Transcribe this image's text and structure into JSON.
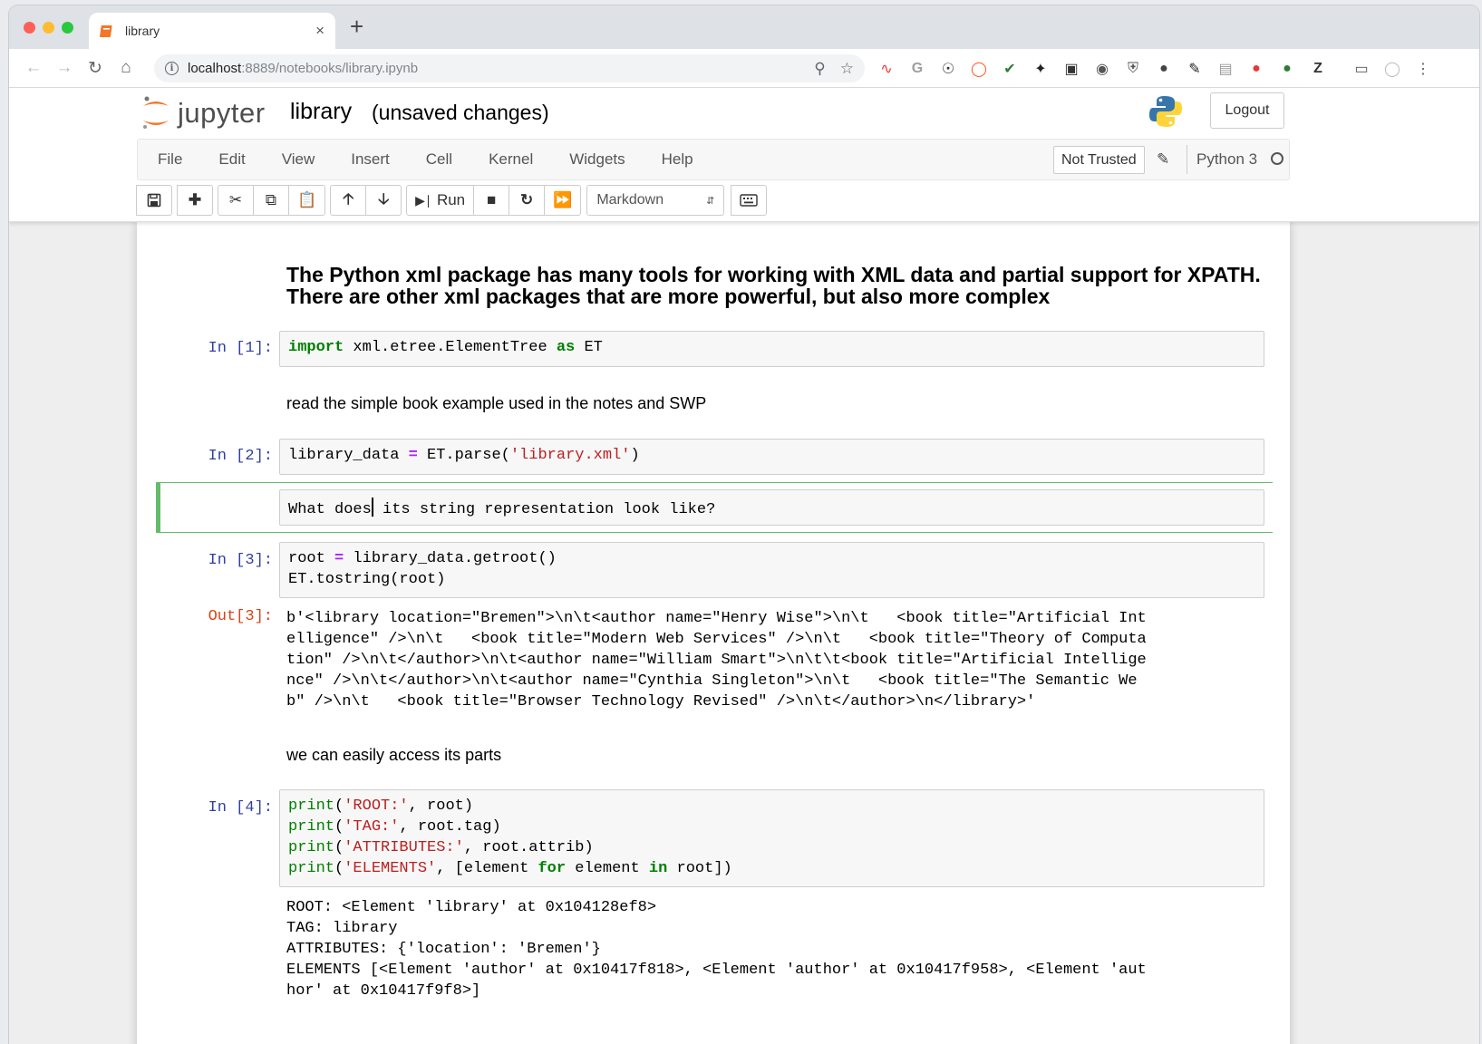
{
  "browser": {
    "tab_title": "library",
    "tab_close": "×",
    "new_tab": "+",
    "url_host": "localhost",
    "url_rest": ":8889/notebooks/library.ipynb",
    "extensions": [
      "trend-icon",
      "g-icon",
      "onepassword-icon",
      "pocket-icon",
      "check-icon",
      "pin-icon",
      "crop-icon",
      "compass-icon",
      "shield-icon",
      "circle-icon",
      "notes-icon",
      "clipboard-icon",
      "todoist-icon",
      "grammarly-icon",
      "zotero-icon",
      "cast-icon",
      "profile-icon",
      "menu-icon"
    ],
    "ext_z": "Z"
  },
  "jupyter": {
    "logo_word": "jupyter",
    "notebook_name": "library",
    "status": "(unsaved changes)",
    "logout": "Logout",
    "menu": [
      "File",
      "Edit",
      "View",
      "Insert",
      "Cell",
      "Kernel",
      "Widgets",
      "Help"
    ],
    "trust": "Not Trusted",
    "kernel": "Python 3",
    "run_label": "Run",
    "cell_type": "Markdown"
  },
  "cells": {
    "heading": "The Python xml package has many tools for working with XML data and partial support for XPATH. There are other xml packages that are more powerful, but also more complex",
    "in1_prompt": "In [1]:",
    "in1_code": {
      "kw1": "import",
      "mid": " xml.etree.ElementTree ",
      "kw2": "as",
      "end": " ET"
    },
    "md1": "read the simple book example used in the notes and SWP",
    "in2_prompt": "In [2]:",
    "in2_code": {
      "a": "library_data ",
      "op": "=",
      "b": " ET.parse(",
      "s": "'library.xml'",
      "c": ")"
    },
    "edit_cell_before": "What does",
    "edit_cell_after": " its string representation look like?",
    "in3_prompt": "In [3]:",
    "in3_code": {
      "a": "root ",
      "op": "=",
      "b": " library_data.getroot()",
      "line2": "ET.tostring(root)"
    },
    "out3_prompt": "Out[3]:",
    "out3_lines": [
      "b'<library location=\"Bremen\">\\n\\t<author name=\"Henry Wise\">\\n\\t   <book title=\"Artificial Int",
      "elligence\" />\\n\\t   <book title=\"Modern Web Services\" />\\n\\t   <book title=\"Theory of Computa",
      "tion\" />\\n\\t</author>\\n\\t<author name=\"William Smart\">\\n\\t\\t<book title=\"Artificial Intellige",
      "nce\" />\\n\\t</author>\\n\\t<author name=\"Cynthia Singleton\">\\n\\t   <book title=\"The Semantic We",
      "b\" />\\n\\t   <book title=\"Browser Technology Revised\" />\\n\\t</author>\\n</library>'"
    ],
    "md2": "we can easily access its parts",
    "in4_prompt": "In [4]:",
    "in4_lines": [
      {
        "fn": "print",
        "open": "(",
        "str": "'ROOT:'",
        "rest": ", root)"
      },
      {
        "fn": "print",
        "open": "(",
        "str": "'TAG:'",
        "rest": ", root.tag)"
      },
      {
        "fn": "print",
        "open": "(",
        "str": "'ATTRIBUTES:'",
        "rest": ", root.attrib)"
      },
      {
        "fn": "print",
        "open": "(",
        "str": "'ELEMENTS'",
        "rest": ", [element ",
        "kw1": "for",
        "rest2": " element ",
        "kw2": "in",
        "rest3": " root])"
      }
    ],
    "out4_lines": [
      "ROOT: <Element 'library' at 0x104128ef8>",
      "TAG: library",
      "ATTRIBUTES: {'location': 'Bremen'}",
      "ELEMENTS [<Element 'author' at 0x10417f818>, <Element 'author' at 0x10417f958>, <Element 'aut",
      "hor' at 0x10417f9f8>]"
    ]
  }
}
